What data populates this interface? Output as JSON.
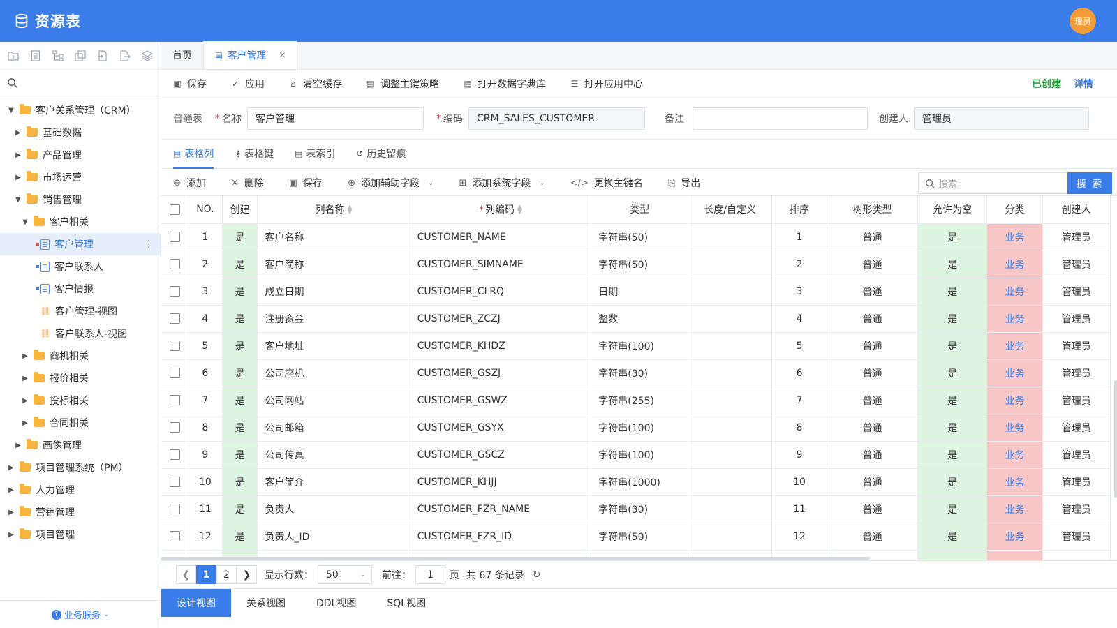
{
  "app": {
    "title": "资源表",
    "avatar_text": "理员"
  },
  "sidebar": {
    "tools": [
      "folder-add-icon",
      "doc-icon",
      "tree-icon",
      "copy-icon",
      "import-icon",
      "export-icon",
      "layers-icon"
    ],
    "tree": [
      {
        "label": "客户关系管理（CRM）",
        "level": 0,
        "kind": "folder",
        "open": true
      },
      {
        "label": "基础数据",
        "level": 1,
        "kind": "folder",
        "open": false
      },
      {
        "label": "产品管理",
        "level": 1,
        "kind": "folder",
        "open": false
      },
      {
        "label": "市场运营",
        "level": 1,
        "kind": "folder",
        "open": false
      },
      {
        "label": "销售管理",
        "level": 1,
        "kind": "folder",
        "open": true
      },
      {
        "label": "客户相关",
        "level": 2,
        "kind": "folder",
        "open": true
      },
      {
        "label": "客户管理",
        "level": 3,
        "kind": "doc",
        "active": true,
        "mark": "#e04545"
      },
      {
        "label": "客户联系人",
        "level": 3,
        "kind": "doc",
        "mark": "#3a7ce8"
      },
      {
        "label": "客户情报",
        "level": 3,
        "kind": "doc",
        "mark": "#3a7ce8"
      },
      {
        "label": "客户管理-视图",
        "level": 3,
        "kind": "view"
      },
      {
        "label": "客户联系人-视图",
        "level": 3,
        "kind": "view"
      },
      {
        "label": "商机相关",
        "level": 2,
        "kind": "folder",
        "open": false
      },
      {
        "label": "报价相关",
        "level": 2,
        "kind": "folder",
        "open": false
      },
      {
        "label": "投标相关",
        "level": 2,
        "kind": "folder",
        "open": false
      },
      {
        "label": "合同相关",
        "level": 2,
        "kind": "folder",
        "open": false
      },
      {
        "label": "画像管理",
        "level": 1,
        "kind": "folder",
        "open": false
      },
      {
        "label": "项目管理系统（PM）",
        "level": 0,
        "kind": "folder",
        "open": false
      },
      {
        "label": "人力管理",
        "level": 0,
        "kind": "folder",
        "open": false
      },
      {
        "label": "营销管理",
        "level": 0,
        "kind": "folder",
        "open": false
      },
      {
        "label": "项目管理",
        "level": 0,
        "kind": "folder",
        "open": false
      }
    ],
    "footer_label": "业务服务"
  },
  "tabs": [
    {
      "label": "首页",
      "active": false
    },
    {
      "label": "客户管理",
      "active": true
    }
  ],
  "toolbar": {
    "buttons": [
      {
        "label": "保存",
        "icon": "save-icon",
        "glyph": "▣"
      },
      {
        "label": "应用",
        "icon": "check-icon",
        "glyph": "✓"
      },
      {
        "label": "清空缓存",
        "icon": "broom-icon",
        "glyph": "⌂"
      },
      {
        "label": "调整主键策略",
        "icon": "key-doc-icon",
        "glyph": "▤"
      },
      {
        "label": "打开数据字典库",
        "icon": "dictionary-icon",
        "glyph": "▤"
      },
      {
        "label": "打开应用中心",
        "icon": "apps-icon",
        "glyph": "☰"
      }
    ],
    "status": "已创建",
    "detail": "详情"
  },
  "form": {
    "type_label": "普通表",
    "name_label": "名称",
    "name_value": "客户管理",
    "code_label": "编码",
    "code_value": "CRM_SALES_CUSTOMER",
    "remark_label": "备注",
    "remark_value": "",
    "creator_label": "创建人",
    "creator_value": "管理员"
  },
  "subtabs": [
    {
      "label": "表格列",
      "icon": "table-icon",
      "glyph": "▤",
      "active": true
    },
    {
      "label": "表格键",
      "icon": "key-icon",
      "glyph": "⚷",
      "active": false
    },
    {
      "label": "表索引",
      "icon": "index-icon",
      "glyph": "▤",
      "active": false
    },
    {
      "label": "历史留痕",
      "icon": "history-icon",
      "glyph": "↺",
      "active": false
    }
  ],
  "grid_toolbar": {
    "buttons": [
      {
        "label": "添加",
        "icon": "plus-circle-icon",
        "glyph": "⊕",
        "dropdown": false
      },
      {
        "label": "删除",
        "icon": "x-icon",
        "glyph": "✕",
        "dropdown": false
      },
      {
        "label": "保存",
        "icon": "save-icon",
        "glyph": "▣",
        "dropdown": false
      },
      {
        "label": "添加辅助字段",
        "icon": "add-aux-icon",
        "glyph": "⊕",
        "dropdown": true
      },
      {
        "label": "添加系统字段",
        "icon": "add-sys-icon",
        "glyph": "⊞",
        "dropdown": true
      },
      {
        "label": "更换主键名",
        "icon": "code-icon",
        "glyph": "</>",
        "dropdown": false
      },
      {
        "label": "导出",
        "icon": "export-file-icon",
        "glyph": "⎘",
        "dropdown": false
      }
    ],
    "search_placeholder": "搜索",
    "search_button": "搜 索"
  },
  "table": {
    "headers": [
      "NO.",
      "创建",
      "列名称",
      "列编码",
      "类型",
      "长度/自定义",
      "排序",
      "树形类型",
      "允许为空",
      "分类",
      "创建人"
    ],
    "rows": [
      {
        "no": "1",
        "created": "是",
        "name": "客户名称",
        "code": "CUSTOMER_NAME",
        "type": "字符串(50)",
        "length": "",
        "order": "1",
        "tree": "普通",
        "nullable": "是",
        "category": "业务",
        "creator": "管理员"
      },
      {
        "no": "2",
        "created": "是",
        "name": "客户简称",
        "code": "CUSTOMER_SIMNAME",
        "type": "字符串(50)",
        "length": "",
        "order": "2",
        "tree": "普通",
        "nullable": "是",
        "category": "业务",
        "creator": "管理员"
      },
      {
        "no": "3",
        "created": "是",
        "name": "成立日期",
        "code": "CUSTOMER_CLRQ",
        "type": "日期",
        "length": "",
        "order": "3",
        "tree": "普通",
        "nullable": "是",
        "category": "业务",
        "creator": "管理员"
      },
      {
        "no": "4",
        "created": "是",
        "name": "注册资金",
        "code": "CUSTOMER_ZCZJ",
        "type": "整数",
        "length": "",
        "order": "4",
        "tree": "普通",
        "nullable": "是",
        "category": "业务",
        "creator": "管理员"
      },
      {
        "no": "5",
        "created": "是",
        "name": "客户地址",
        "code": "CUSTOMER_KHDZ",
        "type": "字符串(100)",
        "length": "",
        "order": "5",
        "tree": "普通",
        "nullable": "是",
        "category": "业务",
        "creator": "管理员"
      },
      {
        "no": "6",
        "created": "是",
        "name": "公司座机",
        "code": "CUSTOMER_GSZJ",
        "type": "字符串(30)",
        "length": "",
        "order": "6",
        "tree": "普通",
        "nullable": "是",
        "category": "业务",
        "creator": "管理员"
      },
      {
        "no": "7",
        "created": "是",
        "name": "公司网站",
        "code": "CUSTOMER_GSWZ",
        "type": "字符串(255)",
        "length": "",
        "order": "7",
        "tree": "普通",
        "nullable": "是",
        "category": "业务",
        "creator": "管理员"
      },
      {
        "no": "8",
        "created": "是",
        "name": "公司邮箱",
        "code": "CUSTOMER_GSYX",
        "type": "字符串(100)",
        "length": "",
        "order": "8",
        "tree": "普通",
        "nullable": "是",
        "category": "业务",
        "creator": "管理员"
      },
      {
        "no": "9",
        "created": "是",
        "name": "公司传真",
        "code": "CUSTOMER_GSCZ",
        "type": "字符串(100)",
        "length": "",
        "order": "9",
        "tree": "普通",
        "nullable": "是",
        "category": "业务",
        "creator": "管理员"
      },
      {
        "no": "10",
        "created": "是",
        "name": "客户简介",
        "code": "CUSTOMER_KHJJ",
        "type": "字符串(1000)",
        "length": "",
        "order": "10",
        "tree": "普通",
        "nullable": "是",
        "category": "业务",
        "creator": "管理员"
      },
      {
        "no": "11",
        "created": "是",
        "name": "负责人",
        "code": "CUSTOMER_FZR_NAME",
        "type": "字符串(30)",
        "length": "",
        "order": "11",
        "tree": "普通",
        "nullable": "是",
        "category": "业务",
        "creator": "管理员"
      },
      {
        "no": "12",
        "created": "是",
        "name": "负责人_ID",
        "code": "CUSTOMER_FZR_ID",
        "type": "字符串(50)",
        "length": "",
        "order": "12",
        "tree": "普通",
        "nullable": "是",
        "category": "业务",
        "creator": "管理员"
      },
      {
        "no": "",
        "created": "",
        "name": "",
        "code": "",
        "type": "",
        "length": "",
        "order": "",
        "tree": "",
        "nullable": "",
        "category": "",
        "creator": ""
      }
    ]
  },
  "pager": {
    "current_page": "1",
    "next_page": "2",
    "rows_label": "显示行数：",
    "rows_value": "50",
    "goto_label": "前往：",
    "goto_value": "1",
    "page_unit": "页",
    "total_text": "共 67 条记录"
  },
  "view_tabs": [
    {
      "label": "设计视图",
      "active": true
    },
    {
      "label": "关系视图",
      "active": false
    },
    {
      "label": "DDL视图",
      "active": false
    },
    {
      "label": "SQL视图",
      "active": false
    }
  ],
  "colors": {
    "primary": "#3a7ce8",
    "success": "#2f9e44",
    "nullable_bg": "#ddf5e1",
    "category_bg": "#f8c8c8",
    "folder": "#f7b53f",
    "avatar": "#f39c3a"
  }
}
